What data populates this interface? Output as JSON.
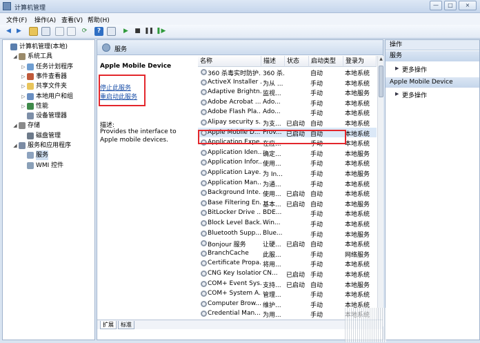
{
  "window": {
    "title": "计算机管理",
    "controls": [
      "—",
      "□",
      "×"
    ]
  },
  "menu": [
    "文件(F)",
    "操作(A)",
    "查看(V)",
    "帮助(H)"
  ],
  "tree": [
    {
      "label": "计算机管理(本地)",
      "level": 0,
      "twisty": "",
      "icon": "computer-icon",
      "color": "#5b7fae"
    },
    {
      "label": "系统工具",
      "level": 1,
      "twisty": "◢",
      "icon": "tools-icon",
      "color": "#9a8a6a"
    },
    {
      "label": "任务计划程序",
      "level": 2,
      "twisty": "▷",
      "icon": "clock-icon",
      "color": "#6f9ed1"
    },
    {
      "label": "事件查看器",
      "level": 2,
      "twisty": "▷",
      "icon": "event-viewer-icon",
      "color": "#c05a3a"
    },
    {
      "label": "共享文件夹",
      "level": 2,
      "twisty": "▷",
      "icon": "folder-icon",
      "color": "#e8c45a"
    },
    {
      "label": "本地用户和组",
      "level": 2,
      "twisty": "▷",
      "icon": "users-icon",
      "color": "#6a8fc2"
    },
    {
      "label": "性能",
      "level": 2,
      "twisty": "▷",
      "icon": "performance-icon",
      "color": "#3f8a4a"
    },
    {
      "label": "设备管理器",
      "level": 2,
      "twisty": "",
      "icon": "device-manager-icon",
      "color": "#7d8fa8"
    },
    {
      "label": "存储",
      "level": 1,
      "twisty": "◢",
      "icon": "storage-icon",
      "color": "#8a8a8a"
    },
    {
      "label": "磁盘管理",
      "level": 2,
      "twisty": "",
      "icon": "disk-icon",
      "color": "#6d7a8a"
    },
    {
      "label": "服务和应用程序",
      "level": 1,
      "twisty": "◢",
      "icon": "services-apps-icon",
      "color": "#7c8ca4"
    },
    {
      "label": "服务",
      "level": 2,
      "twisty": "",
      "icon": "services-icon",
      "color": "#8da3bf"
    },
    {
      "label": "WMI 控件",
      "level": 2,
      "twisty": "",
      "icon": "wmi-icon",
      "color": "#8aa0b8"
    }
  ],
  "center": {
    "header": "服务",
    "selected_service": "Apple Mobile Device",
    "stop_link": "停止此服务",
    "restart_link": "重启动此服务",
    "desc_label": "描述:",
    "desc_text": "Provides the interface to Apple mobile devices."
  },
  "columns": [
    "名称",
    "描述",
    "状态",
    "启动类型",
    "登录为"
  ],
  "services": [
    [
      "360 杀毒实时防护...",
      "360 杀...",
      "",
      "自动",
      "本地系统"
    ],
    [
      "ActiveX Installer ...",
      "为从 ...",
      "",
      "手动",
      "本地系统"
    ],
    [
      "Adaptive Brightn...",
      "监视...",
      "",
      "手动",
      "本地服务"
    ],
    [
      "Adobe Acrobat ...",
      "Ado...",
      "",
      "手动",
      "本地系统"
    ],
    [
      "Adobe Flash Pla...",
      "Ado...",
      "",
      "手动",
      "本地系统"
    ],
    [
      "Alipay security s...",
      "为支...",
      "已启动",
      "自动",
      "本地系统"
    ],
    [
      "Apple Mobile D...",
      "Prov...",
      "已启动",
      "自动",
      "本地系统"
    ],
    [
      "Application Expe...",
      "在应...",
      "",
      "手动",
      "本地系统"
    ],
    [
      "Application Iden...",
      "确定...",
      "",
      "手动",
      "本地服务"
    ],
    [
      "Application Infor...",
      "使用...",
      "",
      "手动",
      "本地系统"
    ],
    [
      "Application Laye...",
      "为 In...",
      "",
      "手动",
      "本地服务"
    ],
    [
      "Application Man...",
      "为通...",
      "",
      "手动",
      "本地系统"
    ],
    [
      "Background Inte...",
      "使用...",
      "已启动",
      "自动",
      "本地系统"
    ],
    [
      "Base Filtering En...",
      "基本...",
      "已启动",
      "自动",
      "本地服务"
    ],
    [
      "BitLocker Drive ...",
      "BDE...",
      "",
      "手动",
      "本地系统"
    ],
    [
      "Block Level Back...",
      "Win...",
      "",
      "手动",
      "本地系统"
    ],
    [
      "Bluetooth Supp...",
      "Blue...",
      "",
      "手动",
      "本地服务"
    ],
    [
      "Bonjour 服务",
      "让硬...",
      "已启动",
      "自动",
      "本地系统"
    ],
    [
      "BranchCache",
      "此服...",
      "",
      "手动",
      "网络服务"
    ],
    [
      "Certificate Propa...",
      "将用...",
      "",
      "手动",
      "本地系统"
    ],
    [
      "CNG Key Isolation",
      "CN...",
      "已启动",
      "手动",
      "本地系统"
    ],
    [
      "COM+ Event Sys...",
      "支持...",
      "已启动",
      "自动",
      "本地服务"
    ],
    [
      "COM+ System A...",
      "管理...",
      "",
      "手动",
      "本地系统"
    ],
    [
      "Computer Brow...",
      "维护...",
      "",
      "手动",
      "本地系统"
    ],
    [
      "Credential Man...",
      "为用...",
      "",
      "手动",
      "本地系统"
    ]
  ],
  "tabs": [
    "扩展",
    "标准"
  ],
  "actions": {
    "title": "操作",
    "group1": "服务",
    "group2": "Apple Mobile Device",
    "more": "更多操作"
  },
  "colors": {
    "highlight_box": "#e3262b",
    "link": "#1a4fa8"
  }
}
